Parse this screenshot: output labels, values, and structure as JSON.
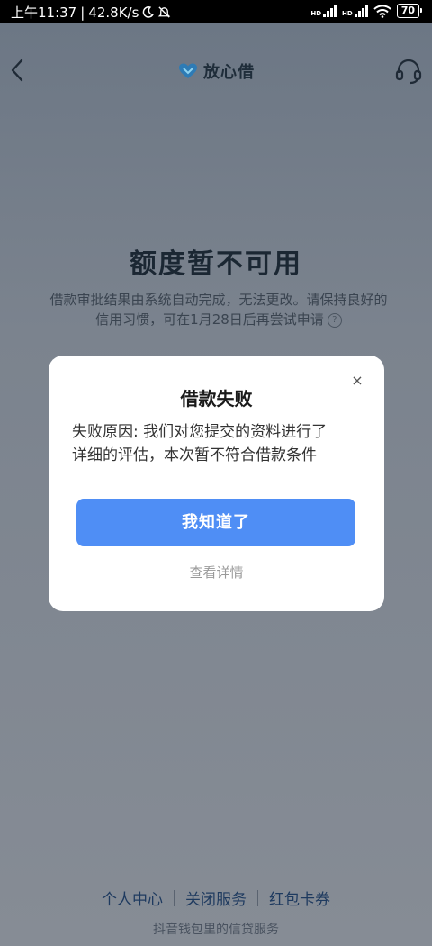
{
  "status_bar": {
    "time": "上午11:37",
    "speed": "42.8K/s",
    "network_badges": [
      "HD",
      "HD"
    ],
    "battery": "70"
  },
  "nav": {
    "back_icon": "chevron-left-icon",
    "brand_name": "放心借",
    "support_icon": "headset-icon"
  },
  "page": {
    "title": "额度暂不可用",
    "desc_line1": "借款审批结果由系统自动完成，无法更改。请保持良好的",
    "desc_line2": "信用习惯，可在1月28日后再尝试申请",
    "help_glyph": "?"
  },
  "modal": {
    "close_glyph": "×",
    "title": "借款失败",
    "body_line1": "失败原因: 我们对您提交的资料进行了",
    "body_line2": "详细的评估，本次暂不符合借款条件",
    "primary_button": "我知道了",
    "secondary_link": "查看详情"
  },
  "footer": {
    "links": [
      "个人中心",
      "关闭服务",
      "红包卡券"
    ],
    "note": "抖音钱包里的信贷服务"
  },
  "colors": {
    "accent": "#4f8ef5",
    "overlay": "#7b838e",
    "status_bar": "#000000"
  }
}
